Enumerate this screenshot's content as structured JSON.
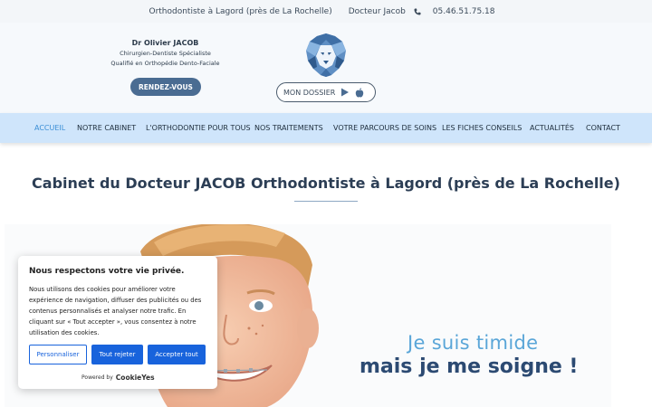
{
  "topbar": {
    "title": "Orthodontiste à Lagord (près de La Rochelle)",
    "doctor": "Docteur Jacob",
    "phone": "05.46.51.75.18",
    "phone_icon": "phone-icon"
  },
  "header": {
    "doctor_name": "Dr Olivier JACOB",
    "line1": "Chirurgien-Dentiste Spécialiste",
    "line2": "Qualifié en Orthopédie Dento-Faciale",
    "rdv_label": "RENDEZ-VOUS",
    "logo_icon": "lion-logo-icon",
    "dossier_label": "MON DOSSIER",
    "play_icon": "google-play-icon",
    "apple_icon": "apple-icon"
  },
  "nav": {
    "items": [
      "ACCUEIL",
      "NOTRE CABINET",
      "L'ORTHODONTIE POUR TOUS",
      "NOS TRAITEMENTS",
      "VOTRE PARCOURS DE SOINS",
      "LES FICHES CONSEILS",
      "ACTUALITÉS",
      "CONTACT"
    ],
    "active_color": "#3c8fd6"
  },
  "main": {
    "title": "Cabinet du Docteur JACOB Orthodontiste à Lagord (près de La Rochelle)",
    "slogan_line1": "Je suis timide",
    "slogan_line2": "mais je me soigne !"
  },
  "cookie": {
    "title": "Nous respectons votre vie privée.",
    "text": "Nous utilisons des cookies pour améliorer votre expérience de navigation, diffuser des publicités ou des contenus personnalisés et analyser notre trafic. En cliquant sur « Tout accepter », vous consentez à notre utilisation des cookies.",
    "btn_customize": "Personnaliser",
    "btn_reject": "Tout rejeter",
    "btn_accept": "Accepter tout",
    "powered_by": "Powered by",
    "brand": "CookieYes",
    "accent": "#1863dc"
  }
}
